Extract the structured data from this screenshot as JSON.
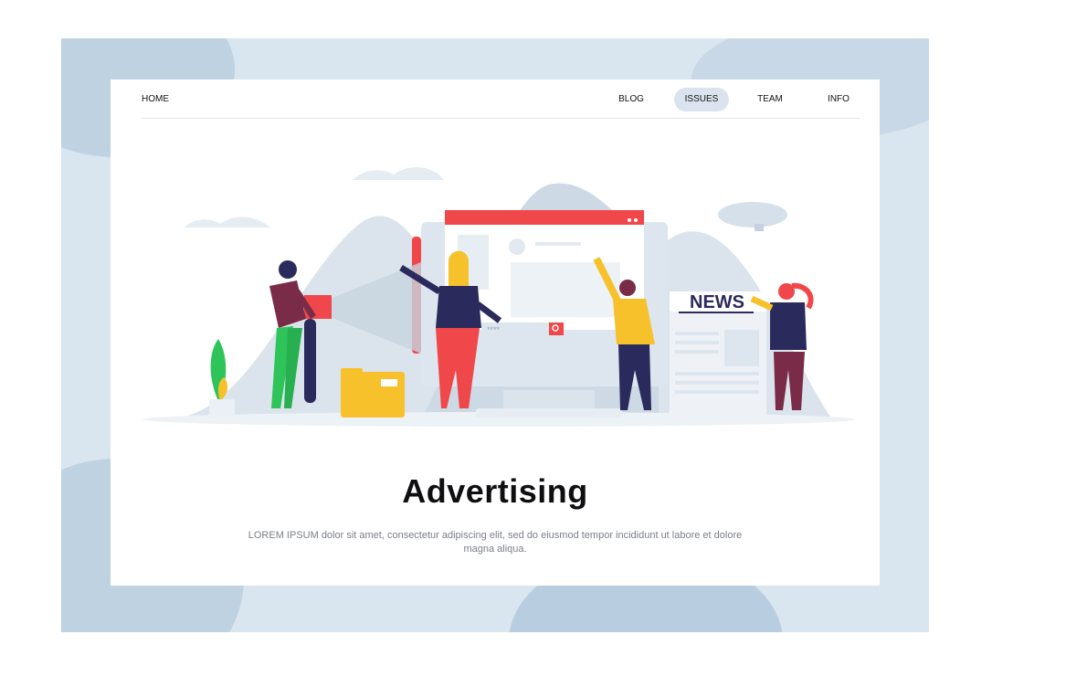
{
  "nav": {
    "home": "HOME",
    "items": [
      "BLOG",
      "ISSUES",
      "TEAM",
      "INFO"
    ],
    "active": "ISSUES"
  },
  "hero": {
    "title": "Advertising",
    "description": "LOREM IPSUM dolor sit amet, consectetur adipiscing elit, sed do eiusmod tempor incididunt ut labore et dolore magna aliqua."
  },
  "illustration": {
    "newspaper_label": "NEWS",
    "search_placeholder": "****"
  },
  "colors": {
    "backdrop": "#d9e5ef",
    "accent_red": "#f0474a",
    "accent_yellow": "#f6c12a",
    "navy": "#2b2a5c",
    "green": "#2ec45a"
  }
}
